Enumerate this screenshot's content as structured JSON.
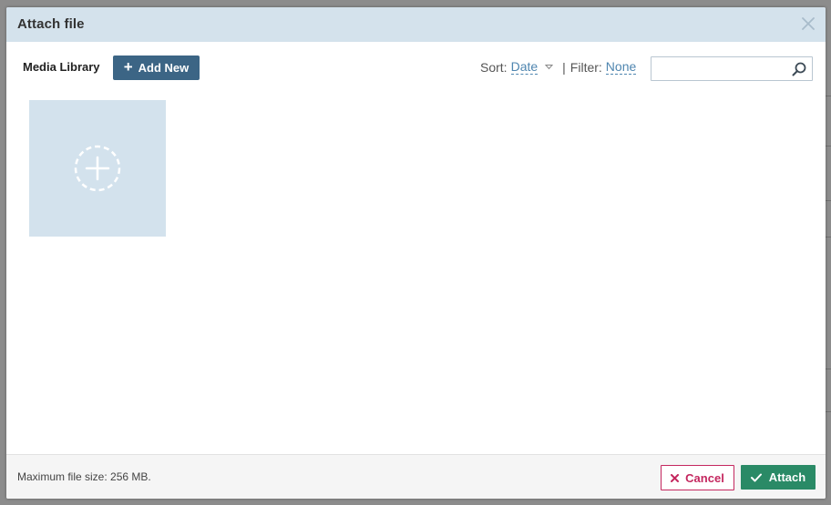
{
  "dialog": {
    "title": "Attach file"
  },
  "toolbar": {
    "library_label": "Media Library",
    "add_new_label": "Add New",
    "sort_label": "Sort:",
    "sort_value": "Date",
    "separator": "|",
    "filter_label": "Filter:",
    "filter_value": "None",
    "search_placeholder": ""
  },
  "footer": {
    "max_size_text": "Maximum file size: 256 MB.",
    "cancel_label": "Cancel",
    "attach_label": "Attach"
  },
  "icons": {
    "close": "close-icon",
    "add": "plus-icon",
    "sort_caret": "chevron-down-icon",
    "search": "search-icon",
    "upload": "add-circle-dashed-icon",
    "cancel": "x-icon",
    "attach": "check-icon"
  },
  "colors": {
    "header_bg": "#d4e2ec",
    "primary": "#3c6585",
    "link": "#4f86b0",
    "tile_bg": "#d3e2ed",
    "danger": "#c4275f",
    "success": "#2a8a66"
  }
}
